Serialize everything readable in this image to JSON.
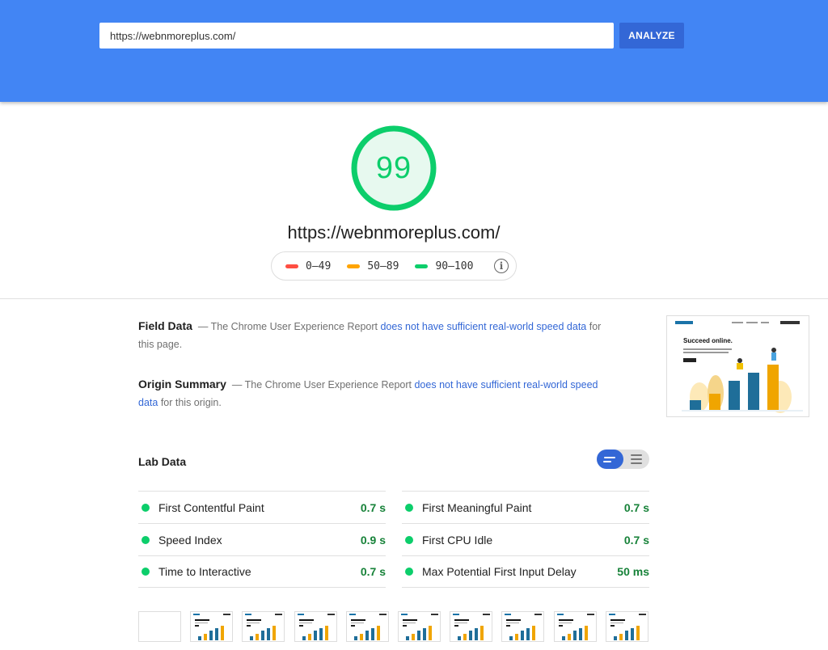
{
  "search": {
    "value": "https://webnmoreplus.com/",
    "button_label": "ANALYZE"
  },
  "score": {
    "value": "99",
    "tested_url": "https://webnmoreplus.com/"
  },
  "legend": [
    {
      "label": "0–49",
      "color": "#ff4e42"
    },
    {
      "label": "50–89",
      "color": "#ffa400"
    },
    {
      "label": "90–100",
      "color": "#0cce6b"
    }
  ],
  "legend_info_icon": "info-icon",
  "field_data": {
    "title": "Field Data",
    "prefix": "— The Chrome User Experience Report ",
    "link": "does not have sufficient real-world speed data",
    "suffix": " for this page."
  },
  "origin_summary": {
    "title": "Origin Summary",
    "prefix": "— The Chrome User Experience Report ",
    "link": "does not have sufficient real-world speed data",
    "suffix": " for this origin."
  },
  "preview": {
    "headline": "Succeed online."
  },
  "lab_data": {
    "title": "Lab Data",
    "metrics_left": [
      {
        "label": "First Contentful Paint",
        "value": "0.7 s"
      },
      {
        "label": "Speed Index",
        "value": "0.9 s"
      },
      {
        "label": "Time to Interactive",
        "value": "0.7 s"
      }
    ],
    "metrics_right": [
      {
        "label": "First Meaningful Paint",
        "value": "0.7 s"
      },
      {
        "label": "First CPU Idle",
        "value": "0.7 s"
      },
      {
        "label": "Max Potential First Input Delay",
        "value": "50 ms"
      }
    ]
  },
  "colors": {
    "header_bg": "#4285f4",
    "button_bg": "#3367d6",
    "pass": "#0cce6b",
    "pass_text": "#178239",
    "link": "#3367d6"
  }
}
